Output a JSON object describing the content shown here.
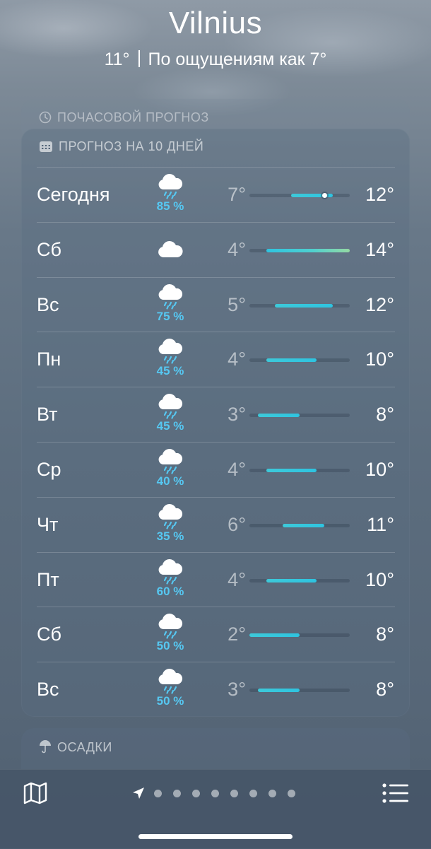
{
  "header": {
    "city": "Vilnius",
    "temperature": "11°",
    "feels_like": "По ощущениям как 7°"
  },
  "hourly": {
    "title": "ПОЧАСОВОЙ ПРОГНОЗ",
    "icon": "clock-icon"
  },
  "forecast": {
    "title": "ПРОГНОЗ НА 10 ДНЕЙ",
    "icon": "calendar-icon",
    "range_min": 2,
    "range_max": 14,
    "current_temp": 11,
    "days": [
      {
        "day": "Сегодня",
        "icon": "cloud-rain-icon",
        "precip": "85 %",
        "low": "7°",
        "high": "12°",
        "lo": 7,
        "hi": 12
      },
      {
        "day": "Сб",
        "icon": "cloud-icon",
        "precip": "",
        "low": "4°",
        "high": "14°",
        "lo": 4,
        "hi": 14
      },
      {
        "day": "Вс",
        "icon": "cloud-rain-icon",
        "precip": "75 %",
        "low": "5°",
        "high": "12°",
        "lo": 5,
        "hi": 12
      },
      {
        "day": "Пн",
        "icon": "cloud-rain-icon",
        "precip": "45 %",
        "low": "4°",
        "high": "10°",
        "lo": 4,
        "hi": 10
      },
      {
        "day": "Вт",
        "icon": "cloud-rain-icon",
        "precip": "45 %",
        "low": "3°",
        "high": "8°",
        "lo": 3,
        "hi": 8
      },
      {
        "day": "Ср",
        "icon": "cloud-rain-icon",
        "precip": "40 %",
        "low": "4°",
        "high": "10°",
        "lo": 4,
        "hi": 10
      },
      {
        "day": "Чт",
        "icon": "cloud-rain-icon",
        "precip": "35 %",
        "low": "6°",
        "high": "11°",
        "lo": 6,
        "hi": 11
      },
      {
        "day": "Пт",
        "icon": "cloud-rain-icon",
        "precip": "60 %",
        "low": "4°",
        "high": "10°",
        "lo": 4,
        "hi": 10
      },
      {
        "day": "Сб",
        "icon": "cloud-rain-icon",
        "precip": "50 %",
        "low": "2°",
        "high": "8°",
        "lo": 2,
        "hi": 8
      },
      {
        "day": "Вс",
        "icon": "cloud-rain-icon",
        "precip": "50 %",
        "low": "3°",
        "high": "8°",
        "lo": 3,
        "hi": 8
      }
    ]
  },
  "precipitation": {
    "title": "ОСАДКИ",
    "icon": "umbrella-icon"
  },
  "toolbar": {
    "map_icon": "map-icon",
    "list_icon": "list-icon",
    "location_icon": "location-arrow-icon",
    "page_dots": 8
  },
  "colors": {
    "precip": "#56c8f2",
    "bar": "#2ec4e0",
    "bar_warm": "#95d9a3"
  }
}
